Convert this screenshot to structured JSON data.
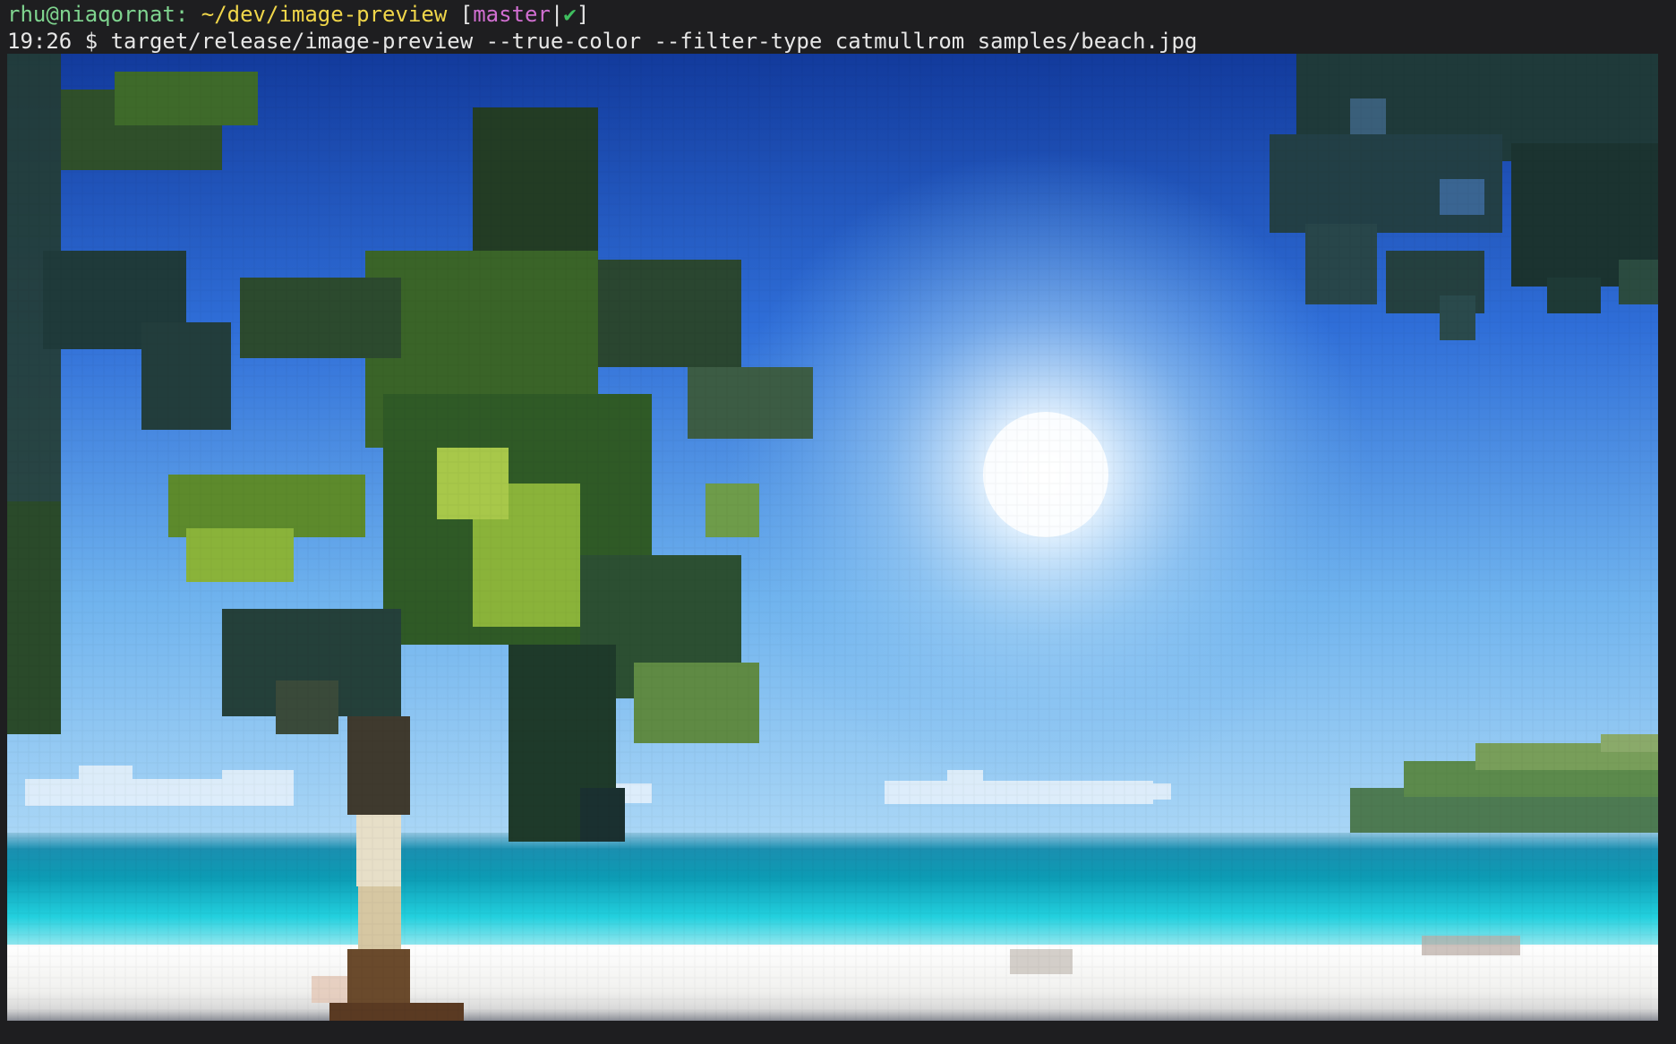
{
  "prompt": {
    "user_host": "rhu@niaqornat:",
    "path": "~/dev/image-preview",
    "open_bracket": "[",
    "branch": "master",
    "separator": "|",
    "status_icon": "check-icon",
    "status_glyph": "✔",
    "close_bracket": "]"
  },
  "command_line": {
    "time": "19:26",
    "symbol": "$",
    "command": "target/release/image-preview --true-color --filter-type catmullrom samples/beach.jpg"
  },
  "preview_image": {
    "subject": "pixelated beach scene with palm tree, sun, sea and sand",
    "colors": {
      "sky_top": "#123a9c",
      "sky_mid": "#3a7de0",
      "sky_low": "#8cc6f2",
      "sun": "#ffffff",
      "sea_dark": "#0d8fa8",
      "sea_light": "#22d2e0",
      "sand": "#f4f4f2",
      "palm_dark": "#1d3b22",
      "palm_light": "#8ab33a",
      "trunk": "#5a3a22"
    }
  }
}
